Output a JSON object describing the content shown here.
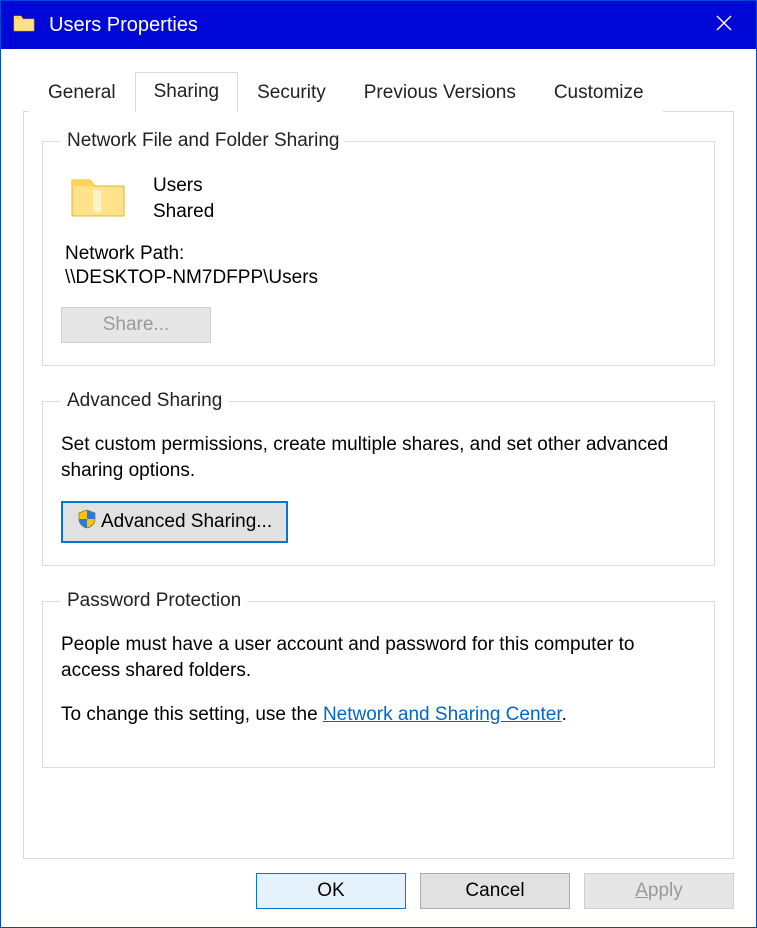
{
  "title": "Users Properties",
  "tabs": {
    "general": "General",
    "sharing": "Sharing",
    "security": "Security",
    "previous": "Previous Versions",
    "customize": "Customize"
  },
  "group_network": {
    "legend": "Network File and Folder Sharing",
    "folder_name": "Users",
    "share_status": "Shared",
    "path_label": "Network Path:",
    "path_value": "\\\\DESKTOP-NM7DFPP\\Users",
    "share_btn": "Share..."
  },
  "group_advanced": {
    "legend": "Advanced Sharing",
    "desc": "Set custom permissions, create multiple shares, and set other advanced sharing options.",
    "btn": "Advanced Sharing..."
  },
  "group_password": {
    "legend": "Password Protection",
    "desc1": "People must have a user account and password for this computer to access shared folders.",
    "desc2_pre": "To change this setting, use the ",
    "link": "Network and Sharing Center",
    "desc2_post": "."
  },
  "footer": {
    "ok": "OK",
    "cancel": "Cancel",
    "apply_pre": "A",
    "apply_post": "pply"
  }
}
